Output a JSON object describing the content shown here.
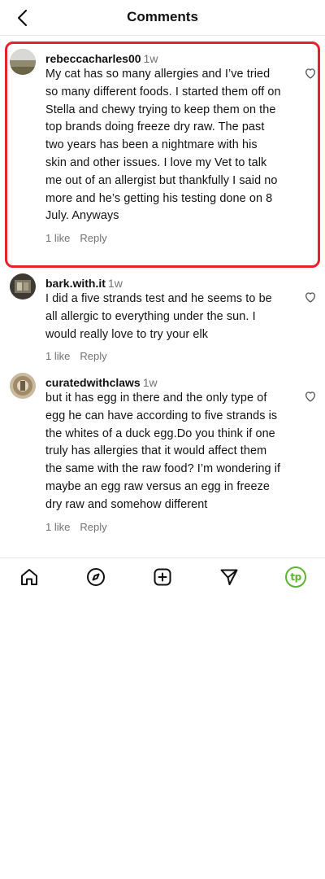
{
  "header": {
    "title": "Comments"
  },
  "comments": [
    {
      "username": "rebeccacharles00",
      "time": "1w",
      "text": "My cat has so many allergies and I’ve tried so many different foods. I started them off on Stella and chewy trying to keep them on the top brands doing freeze dry raw. The past two years has been a nightmare with his skin and other issues. I love my Vet to talk me out of an allergist but thankfully I said no more and he’s getting his testing done on 8 July. Anyways",
      "likes": "1 like",
      "reply": "Reply"
    },
    {
      "username": "bark.with.it",
      "time": "1w",
      "text": "I did a five strands test and he seems to be all allergic to everything under the sun. I would really love to try your elk",
      "likes": "1 like",
      "reply": "Reply"
    },
    {
      "username": "curatedwithclaws",
      "time": "1w",
      "text": "but it has egg in there and the only type of egg he can have according to five strands is the whites of a duck egg.Do you think if one truly has allergies that it would affect them the same with the raw food? I’m wondering if maybe an egg raw versus an egg in freeze dry raw and somehow different",
      "likes": "1 like",
      "reply": "Reply"
    }
  ],
  "tabbar": {
    "profile_initials": "tp"
  },
  "colors": {
    "highlight": "#e8202a",
    "muted": "#737373",
    "profile_ring": "#5db431"
  },
  "icons": [
    "back-arrow-icon",
    "heart-icon",
    "home-icon",
    "explore-compass-icon",
    "create-plus-icon",
    "direct-send-icon",
    "profile-avatar-icon"
  ]
}
